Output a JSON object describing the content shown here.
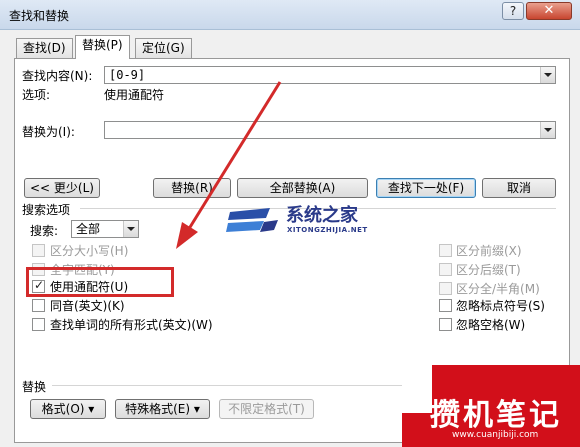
{
  "window": {
    "title": "查找和替换",
    "help_label": "?",
    "close_label": "✕"
  },
  "tabs": [
    {
      "label": "查找(D)",
      "active": false
    },
    {
      "label": "替换(P)",
      "active": true
    },
    {
      "label": "定位(G)",
      "active": false
    }
  ],
  "find": {
    "label": "查找内容(N):",
    "value": "[0-9]",
    "options_label": "选项:",
    "options_value": "使用通配符"
  },
  "replace": {
    "label": "替换为(I):",
    "value": ""
  },
  "buttons": {
    "less": "<< 更少(L)",
    "replace": "替换(R)",
    "replace_all": "全部替换(A)",
    "find_next": "查找下一处(F)",
    "cancel": "取消"
  },
  "search_options": {
    "group_label": "搜索选项",
    "search_label": "搜索:",
    "search_value": "全部"
  },
  "left_checkboxes": [
    {
      "label": "区分大小写(H)",
      "checked": false,
      "disabled": true
    },
    {
      "label": "全字匹配(Y)",
      "checked": false,
      "disabled": true
    },
    {
      "label": "使用通配符(U)",
      "checked": true,
      "disabled": false
    },
    {
      "label": "同音(英文)(K)",
      "checked": false,
      "disabled": false
    },
    {
      "label": "查找单词的所有形式(英文)(W)",
      "checked": false,
      "disabled": false
    }
  ],
  "right_checkboxes": [
    {
      "label": "区分前缀(X)",
      "checked": false,
      "disabled": true
    },
    {
      "label": "区分后缀(T)",
      "checked": false,
      "disabled": true
    },
    {
      "label": "区分全/半角(M)",
      "checked": false,
      "disabled": true
    },
    {
      "label": "忽略标点符号(S)",
      "checked": false,
      "disabled": false
    },
    {
      "label": "忽略空格(W)",
      "checked": false,
      "disabled": false
    }
  ],
  "replace_section": {
    "group_label": "替换",
    "format_button": "格式(O) ▾",
    "special_button": "特殊格式(E) ▾",
    "no_format_button": "不限定格式(T)"
  },
  "watermarks": {
    "top_text": "系统之家",
    "top_url": "XITONGZHIJIA.NET",
    "br_text": "攒机笔记",
    "br_url": "www.cuanjibiji.com"
  },
  "colors": {
    "annotation_red": "#d32a2a",
    "watermark_red": "#d20f1a",
    "watermark_blue": "#2a3a8a"
  }
}
